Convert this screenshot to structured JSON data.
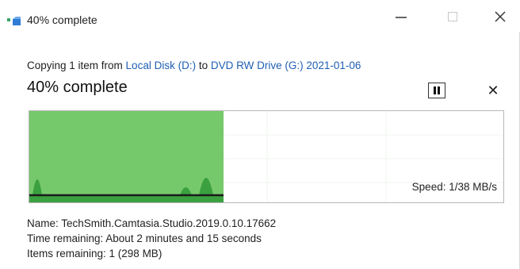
{
  "window": {
    "title": "40% complete",
    "buttons": {
      "minimize": "—",
      "close": "✕"
    }
  },
  "copy": {
    "prefix": "Copying 1 item from ",
    "source": "Local Disk (D:)",
    "middle": " to ",
    "destination": "DVD RW Drive (G:) 2021-01-06",
    "percent_title": "40% complete",
    "progress": 0.4
  },
  "graph": {
    "speed_label": "Speed: 1/38 MB/s"
  },
  "details": {
    "name": "Name:  TechSmith.Camtasia.Studio.2019.0.10.17662",
    "time_remaining": "Time remaining:  About 2 minutes and 15 seconds",
    "items_remaining": "Items remaining:  1 (298 MB)"
  },
  "colors": {
    "progress_fill": "#76c96b",
    "progress_dark": "#3aa040",
    "link": "#1f5fb4"
  },
  "icons": [
    "copy-icon",
    "minimize-icon",
    "maximize-icon",
    "close-icon",
    "pause-icon",
    "cancel-icon"
  ]
}
